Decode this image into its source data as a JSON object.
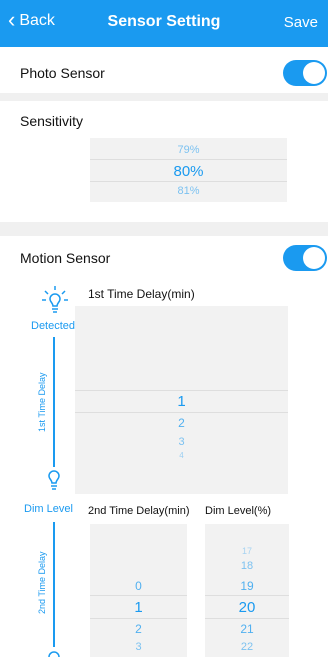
{
  "nav": {
    "back": "Back",
    "title": "Sensor Setting",
    "save": "Save"
  },
  "photo_sensor": {
    "label": "Photo Sensor",
    "enabled": true
  },
  "sensitivity": {
    "label": "Sensitivity",
    "options": [
      "79%",
      "80%",
      "81%"
    ],
    "selected": "80%"
  },
  "motion_sensor": {
    "label": "Motion Sensor",
    "enabled": true
  },
  "timeline": {
    "detected": "Detected",
    "first_delay_vertical": "1st Time Delay",
    "dim_level": "Dim Level",
    "second_delay_vertical": "2nd Time Delay"
  },
  "first_delay": {
    "label": "1st Time Delay(min)",
    "options": [
      "1",
      "2",
      "3",
      "4"
    ],
    "selected": "1"
  },
  "second_delay": {
    "label": "2nd Time Delay(min)",
    "options": [
      "0",
      "1",
      "2",
      "3"
    ],
    "selected": "1"
  },
  "dim_level_picker": {
    "label": "Dim Level(%)",
    "options": [
      "17",
      "18",
      "19",
      "20",
      "21",
      "22"
    ],
    "selected": "20"
  },
  "colors": {
    "accent": "#1a9af0",
    "picker_bg": "#f2f2f2",
    "separator": "#f0f0f0"
  }
}
